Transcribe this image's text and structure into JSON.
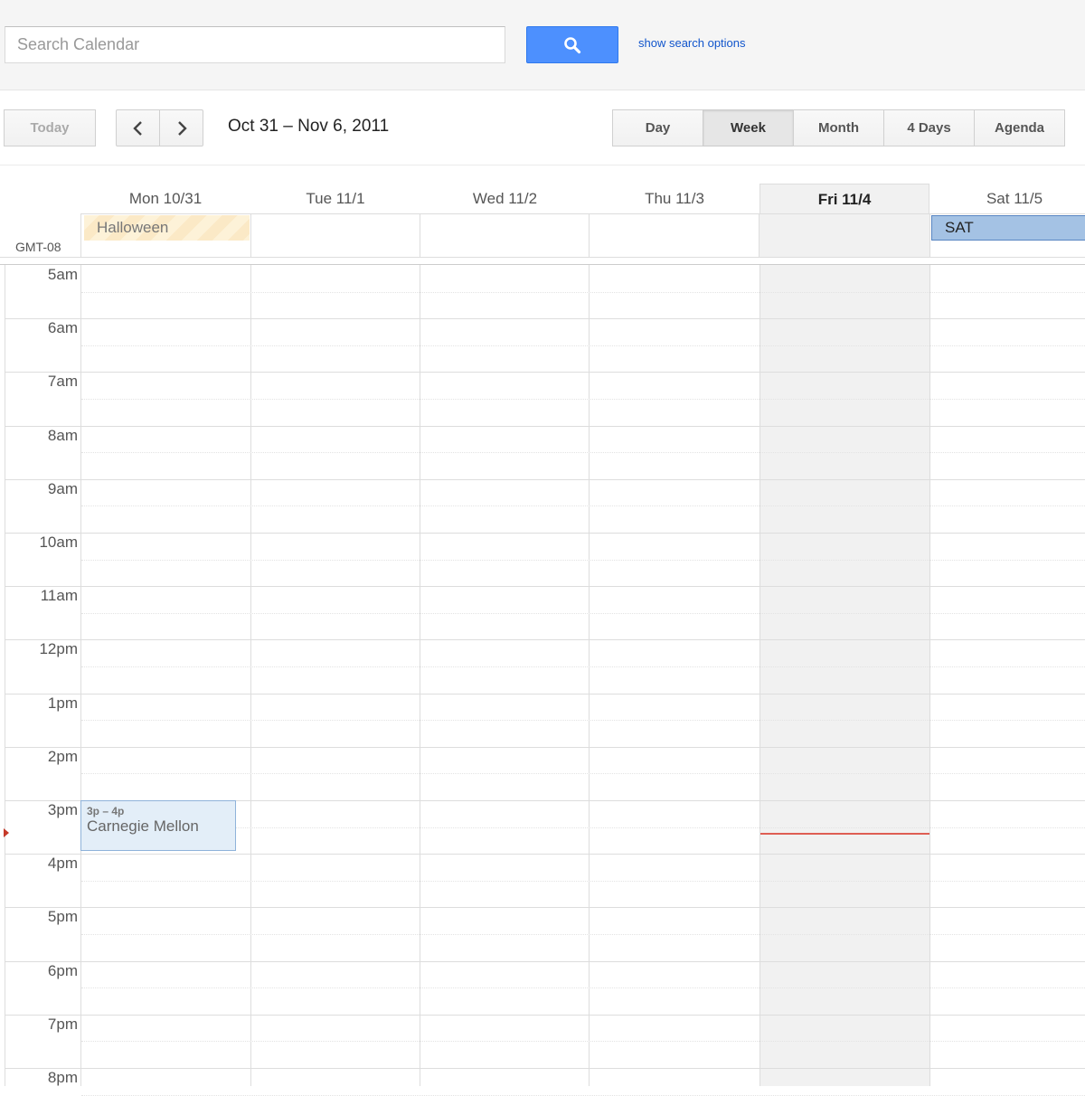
{
  "search": {
    "placeholder": "Search Calendar",
    "value": "",
    "options_label": "show search options"
  },
  "toolbar": {
    "today_label": "Today",
    "date_range": "Oct 31 – Nov 6, 2011",
    "views": [
      {
        "label": "Day",
        "active": false
      },
      {
        "label": "Week",
        "active": true
      },
      {
        "label": "Month",
        "active": false
      },
      {
        "label": "4 Days",
        "active": false
      },
      {
        "label": "Agenda",
        "active": false
      }
    ]
  },
  "calendar": {
    "timezone": "GMT-08",
    "days": [
      {
        "label": "Mon 10/31",
        "today": false
      },
      {
        "label": "Tue 11/1",
        "today": false
      },
      {
        "label": "Wed 11/2",
        "today": false
      },
      {
        "label": "Thu 11/3",
        "today": false
      },
      {
        "label": "Fri 11/4",
        "today": true
      },
      {
        "label": "Sat 11/5",
        "today": false
      }
    ],
    "allday_events": [
      {
        "day": 0,
        "title": "Halloween"
      },
      {
        "day": 5,
        "title": "SAT"
      }
    ],
    "hours": [
      "5am",
      "6am",
      "7am",
      "8am",
      "9am",
      "10am",
      "11am",
      "12pm",
      "1pm",
      "2pm",
      "3pm",
      "4pm",
      "5pm",
      "6pm",
      "7pm",
      "8pm"
    ],
    "events": [
      {
        "day": 0,
        "time": "3p – 4p",
        "title": "Carnegie Mellon"
      }
    ]
  },
  "colors": {
    "accent": "#4d90fe",
    "today_bg": "#f1f1f1",
    "now_line": "#db4437"
  }
}
